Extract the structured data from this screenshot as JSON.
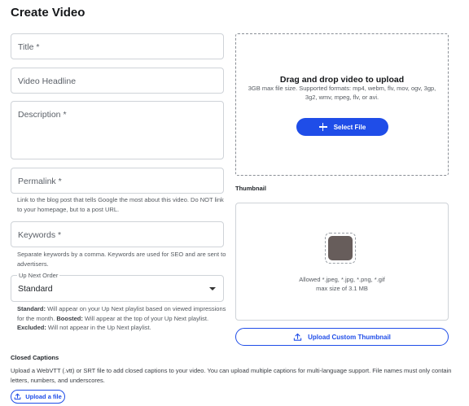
{
  "page": {
    "title": "Create Video"
  },
  "form": {
    "title_placeholder": "Title *",
    "headline_placeholder": "Video Headline",
    "description_placeholder": "Description *",
    "permalink_placeholder": "Permalink *",
    "permalink_help": "Link to the blog post that tells Google the most about this video. Do NOT link to your homepage, but to a post URL.",
    "keywords_placeholder": "Keywords *",
    "keywords_help": "Separate keywords by a comma. Keywords are used for SEO and are sent to advertisers.",
    "upnext": {
      "label": "Up Next Order",
      "value": "Standard",
      "help": [
        {
          "term": "Standard:",
          "text": " Will appear on your Up Next playlist based on viewed impressions for the month. "
        },
        {
          "term": "Boosted:",
          "text": " Will appear at the top of your Up Next playlist. "
        },
        {
          "term": "Excluded:",
          "text": " Will not appear in the Up Next playlist."
        }
      ]
    }
  },
  "dropzone": {
    "title": "Drag and drop video to upload",
    "subtitle": "3GB max file size. Supported formats: mp4, webm, flv, mov, ogv, 3gp, 3g2, wmv, mpeg, flv, or avi.",
    "button_label": "Select File"
  },
  "thumbnail": {
    "heading": "Thumbnail",
    "allowed": "Allowed *.jpeg, *.jpg, *.png, *.gif",
    "max_size": "max size of 3.1 MB",
    "button_label": "Upload Custom Thumbnail"
  },
  "captions": {
    "heading": "Closed Captions",
    "text": "Upload a WebVTT (.vtt) or SRT file to add closed captions to your video. You can upload multiple captions for multi-language support. File names must only contain letters, numbers, and underscores.",
    "button_label": "Upload a file"
  },
  "colors": {
    "accent": "#1f4de8",
    "thumbnail_fill": "#675d5b"
  }
}
